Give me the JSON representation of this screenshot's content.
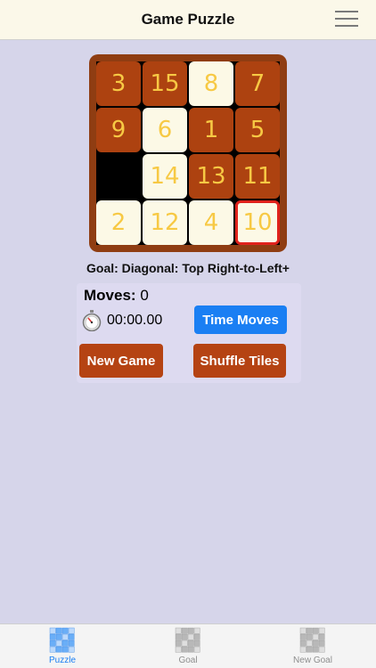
{
  "header": {
    "title": "Game Puzzle",
    "menu_icon": "hamburger-menu-icon"
  },
  "board": {
    "rows": [
      [
        3,
        15,
        8,
        7
      ],
      [
        9,
        6,
        1,
        5
      ],
      [
        null,
        14,
        13,
        11
      ],
      [
        2,
        12,
        4,
        10
      ]
    ],
    "tile_styles": [
      [
        "brown",
        "brown",
        "cream",
        "brown"
      ],
      [
        "brown",
        "cream",
        "brown",
        "brown"
      ],
      [
        "empty",
        "cream",
        "brown",
        "brown"
      ],
      [
        "cream",
        "cream",
        "cream",
        "selected"
      ]
    ],
    "colors": {
      "frame": "#8f3d12",
      "brown_tile": "#ad4210",
      "cream_tile": "#fcf9e6",
      "number": "#f7c944",
      "selected_border": "#e0221c"
    }
  },
  "goal": {
    "text": "Goal: Diagonal: Top Right-to-Left+"
  },
  "stats": {
    "moves_label": "Moves:",
    "moves_value": "0",
    "timer_icon": "stopwatch-icon",
    "timer_value": "00:00.00"
  },
  "buttons": {
    "time_moves": "Time Moves",
    "new_game": "New Game",
    "shuffle_tiles": "Shuffle Tiles"
  },
  "tabs": [
    {
      "label": "Puzzle",
      "icon": "puzzle-grid-icon",
      "active": true
    },
    {
      "label": "Goal",
      "icon": "goal-grid-icon",
      "active": false
    },
    {
      "label": "New Goal",
      "icon": "new-goal-grid-icon",
      "active": false
    }
  ]
}
